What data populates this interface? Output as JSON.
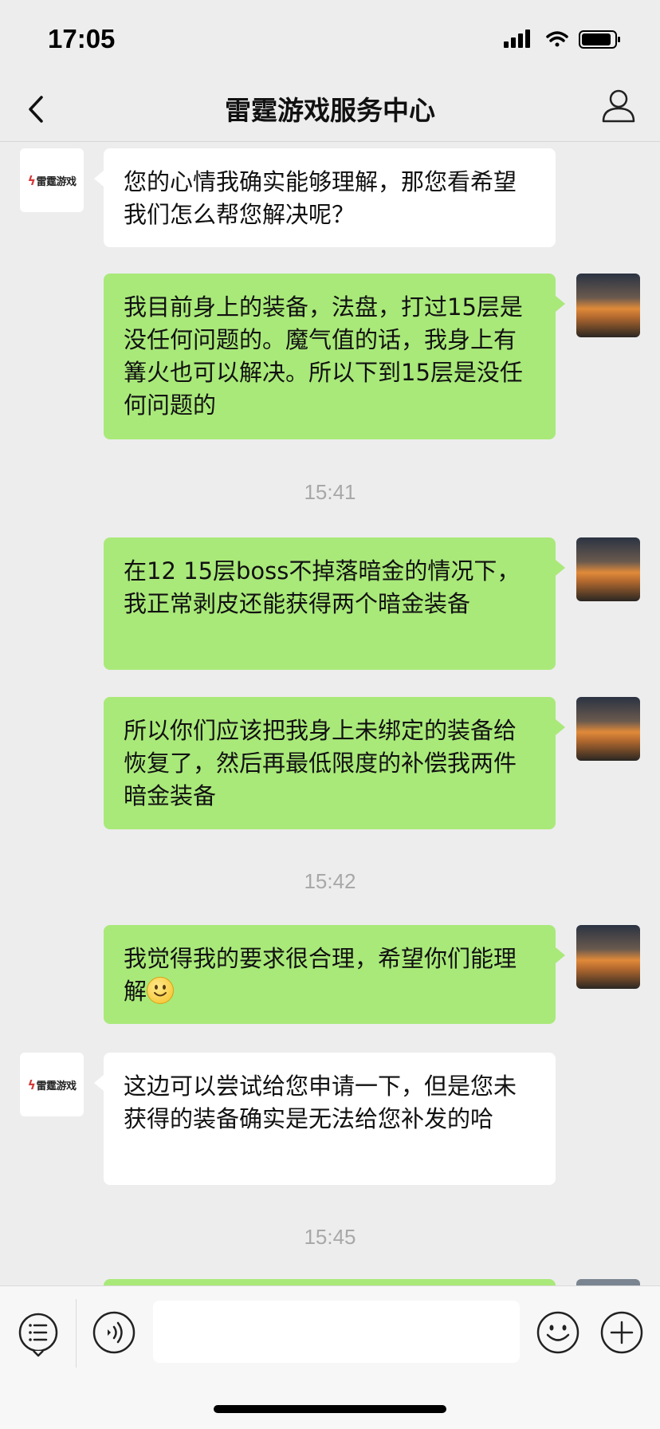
{
  "status_bar": {
    "time": "17:05"
  },
  "nav": {
    "title": "雷霆游戏服务中心"
  },
  "bot": {
    "logo_text": "雷霆游戏"
  },
  "messages": [
    {
      "kind": "in",
      "text": "您的心情我确实能够理解，那您看希望我们怎么帮您解决呢？"
    },
    {
      "kind": "out",
      "text": "我目前身上的装备，法盘，打过15层是没任何问题的。魔气值的话，我身上有篝火也可以解决。所以下到15层是没任何问题的"
    },
    {
      "kind": "time",
      "text": "15:41"
    },
    {
      "kind": "out",
      "text": "在12 15层boss不掉落暗金的情况下，我正常剥皮还能获得两个暗金装备"
    },
    {
      "kind": "out",
      "text": "所以你们应该把我身上未绑定的装备给恢复了，然后再最低限度的补偿我两件暗金装备"
    },
    {
      "kind": "time",
      "text": "15:42"
    },
    {
      "kind": "out",
      "text": "我觉得我的要求很合理，希望你们能理解"
    },
    {
      "kind": "in",
      "text": "这边可以尝试给您申请一下，但是您未获得的装备确实是无法给您补发的哈"
    },
    {
      "kind": "time",
      "text": "15:45"
    }
  ],
  "icons": {
    "back": "chevron-left-icon",
    "profile": "person-icon",
    "menu": "list-menu-icon",
    "voice": "voice-icon",
    "emoji": "emoji-icon",
    "add": "plus-icon"
  }
}
